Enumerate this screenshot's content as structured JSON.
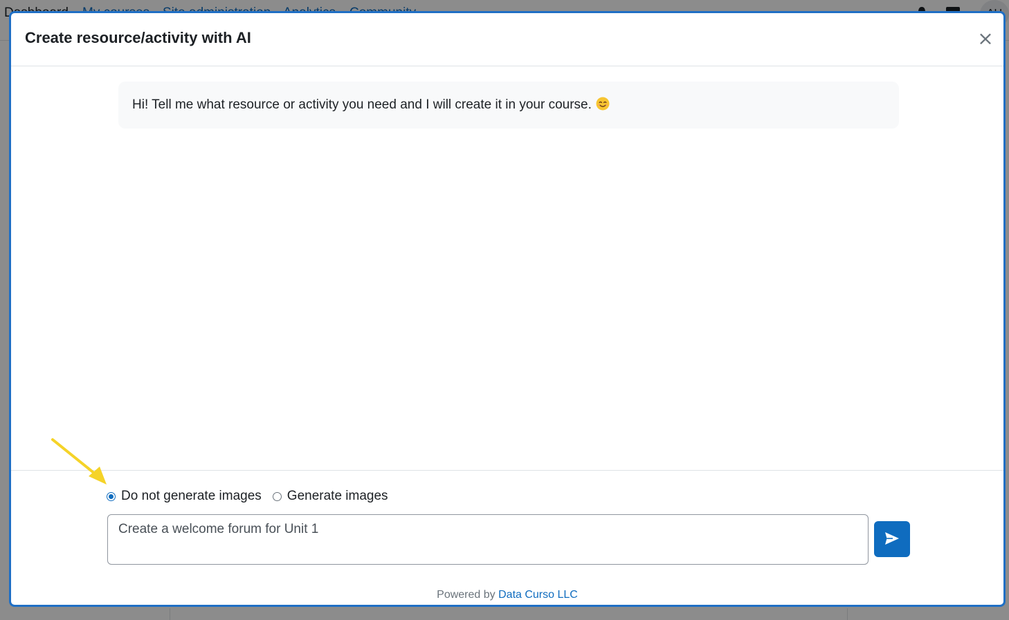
{
  "background": {
    "nav_items": [
      "Dashboard",
      "My courses",
      "Site administration",
      "Analytics",
      "Community"
    ],
    "avatar_initials": "AU"
  },
  "modal": {
    "title": "Create resource/activity with AI",
    "close_glyph": "×"
  },
  "chat": {
    "bot_message": "Hi! Tell me what resource or activity you need and I will create it in your course.",
    "emoji_icon": "smiling-face-icon"
  },
  "image_options": {
    "selected": "no-images",
    "options": [
      {
        "id": "no-images",
        "label": "Do not generate images"
      },
      {
        "id": "images",
        "label": "Generate images"
      }
    ]
  },
  "prompt": {
    "value": "Create a welcome forum for Unit 1",
    "placeholder": ""
  },
  "send_button": {
    "icon": "send-icon"
  },
  "footer": {
    "powered_by": "Powered by",
    "company": "Data Curso LLC"
  },
  "colors": {
    "accent": "#0f6cbf",
    "modal_border": "#1f6fc5",
    "annotation_arrow": "#f5d328",
    "message_bg": "#f8f9fa"
  }
}
